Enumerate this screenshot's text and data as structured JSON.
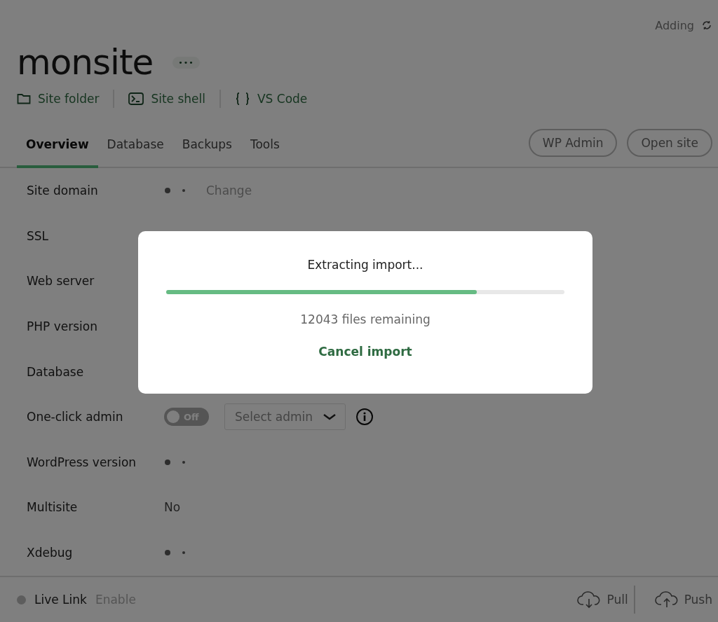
{
  "status": {
    "text": "Adding"
  },
  "site": {
    "title": "monsite",
    "more_label": "•••"
  },
  "quick_links": [
    {
      "kind": "folder",
      "label": "Site folder"
    },
    {
      "kind": "shell",
      "label": "Site shell"
    },
    {
      "kind": "code",
      "label": "VS Code"
    }
  ],
  "tabs": [
    {
      "label": "Overview",
      "selected": true
    },
    {
      "label": "Database",
      "selected": false
    },
    {
      "label": "Backups",
      "selected": false
    },
    {
      "label": "Tools",
      "selected": false
    }
  ],
  "header_buttons": [
    "WP Admin",
    "Open site"
  ],
  "rows": [
    {
      "label": "Site domain",
      "kind": "loading",
      "link": "Change"
    },
    {
      "label": "SSL",
      "kind": "hidden"
    },
    {
      "label": "Web server",
      "kind": "hidden"
    },
    {
      "label": "PHP version",
      "kind": "hidden"
    },
    {
      "label": "Database",
      "kind": "hidden"
    },
    {
      "label": "One-click admin",
      "kind": "admin",
      "toggle": {
        "label": "Off",
        "on": false
      },
      "select_placeholder": "Select admin"
    },
    {
      "label": "WordPress version",
      "kind": "loading"
    },
    {
      "label": "Multisite",
      "kind": "text",
      "value": "No"
    },
    {
      "label": "Xdebug",
      "kind": "loading"
    }
  ],
  "footer": {
    "live_link": "Live Link",
    "enable": "Enable",
    "pull": "Pull",
    "push": "Push"
  },
  "modal": {
    "title": "Extracting import...",
    "level": 0.78,
    "remaining": "12043 files remaining",
    "cancel": "Cancel import"
  }
}
